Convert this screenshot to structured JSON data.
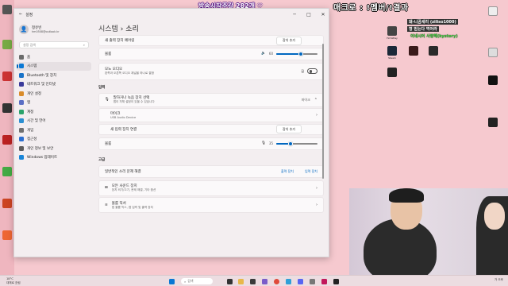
{
  "window": {
    "title": "설정",
    "minimize": "─",
    "maximize": "□",
    "close": "✕"
  },
  "user": {
    "name": "정유빈",
    "email": "hm0508@outlook.kr"
  },
  "search": {
    "placeholder": "설정 검색"
  },
  "nav": [
    {
      "label": "홈",
      "color": "#6b6b6b"
    },
    {
      "label": "시스템",
      "color": "#0a78d4"
    },
    {
      "label": "Bluetooth 및 장치",
      "color": "#1a73c8"
    },
    {
      "label": "네트워크 및 인터넷",
      "color": "#3a3a9a"
    },
    {
      "label": "개인 설정",
      "color": "#d98c2b"
    },
    {
      "label": "앱",
      "color": "#5a6ec4"
    },
    {
      "label": "계정",
      "color": "#2aa36b"
    },
    {
      "label": "시간 및 언어",
      "color": "#2b8fd1"
    },
    {
      "label": "게임",
      "color": "#707070"
    },
    {
      "label": "접근성",
      "color": "#2b6fd1"
    },
    {
      "label": "개인 정보 및 보안",
      "color": "#5c5c5c"
    },
    {
      "label": "Windows 업데이트",
      "color": "#1a86d8"
    }
  ],
  "main": {
    "breadcrumb_parent": "시스템",
    "breadcrumb_sep": "›",
    "breadcrumb_current": "소리",
    "add_output_device": "새 출력 장치 페어링",
    "add_device_btn": "장치 추가",
    "volume_label": "볼륨",
    "volume_value": "60",
    "volume_fraction": 0.6,
    "mono_title": "모노 오디오",
    "mono_desc": "왼쪽과 오른쪽 오디오 채널을 하나로 결합",
    "mono_state": "끔",
    "input_section": "입력",
    "input_select_title": "말하거나 녹음 장치 선택",
    "input_select_desc": "앱이 자체 설정이 있을 수 있습니다",
    "input_device_name": "마이크",
    "input_device_sub": "USB Audio Device",
    "input_dropdown": "마이크",
    "add_input_device": "새 입력 장치 연결",
    "input_volume_label": "볼륨",
    "input_volume_value": "35",
    "input_volume_fraction": 0.35,
    "advanced_section": "고급",
    "troubleshoot_label": "일반적인 소리 문제 해결",
    "output_devices_btn": "출력 장치",
    "input_devices_btn": "입력 장치",
    "all_devices_title": "모든 사운드 장치",
    "all_devices_desc": "장치 켜기/끄기, 문제 해결, 기타 옵션",
    "mixer_title": "볼륨 믹서",
    "mixer_desc": "앱 볼륨 믹스, 앱 입력 및 출력 장치"
  },
  "taskbar": {
    "weather_temp": "18°C",
    "weather_desc": "대체로 흐림",
    "search_placeholder": "검색",
    "time": "오후",
    "lang": "가"
  },
  "stream": {
    "top_banner": "방송시작주갈 282개 ♡",
    "command_banner": "매크로 : !멤버/!결과",
    "donor1": "돼-니곰세리 (ziliso1000)",
    "donor2": "형 믿는다 먹어라",
    "donor3": "이네시어 사랑해(kystory)"
  },
  "desktop_labels": [
    "HoYoPlay",
    "Steam",
    "Epic",
    "GTA",
    "Discord"
  ]
}
